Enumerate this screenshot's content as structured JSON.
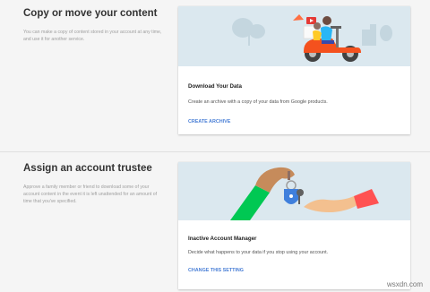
{
  "sections": [
    {
      "heading": "Copy or move your content",
      "description": "You can make a copy of content stored in your account at any time, and use it for another service.",
      "card": {
        "title": "Download Your Data",
        "body": "Create an archive with a copy of your data from Google products.",
        "action": "CREATE ARCHIVE"
      }
    },
    {
      "heading": "Assign an account trustee",
      "description": "Approve a family member or friend to download some of your account content in the event it is left unattended for an amount of time that you've specified.",
      "card": {
        "title": "Inactive Account Manager",
        "body": "Decide what happens to your data if you stop using your account.",
        "action": "CHANGE THIS SETTING"
      }
    }
  ],
  "watermark": "wsxdn.com",
  "colors": {
    "accent": "#4a7fd6",
    "card_art_bg": "#dbe8ef",
    "page_bg": "#f5f5f5"
  }
}
